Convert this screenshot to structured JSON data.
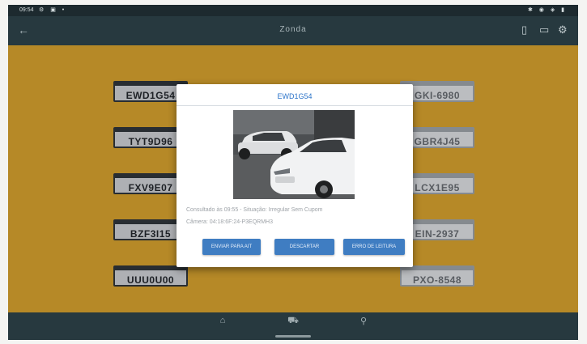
{
  "statusbar": {
    "time": "09:54",
    "left_icons": "⚙ ▣ •",
    "right_icons": "✱ ◉ ◈ ▮"
  },
  "appbar": {
    "title": "Zonda",
    "back_icon": "arrow-left-icon",
    "actions": [
      "tablet-icon",
      "chat-icon",
      "settings-icon"
    ]
  },
  "plates_left": [
    "EWD1G54",
    "TYT9D96",
    "FXV9E07",
    "BZF3I15",
    "UUU0U00"
  ],
  "plates_right": [
    "GKI-6980",
    "GBR4J45",
    "LCX1E95",
    "EIN-2937",
    "PXO-8548"
  ],
  "dialog": {
    "title": "EWD1G54",
    "info_line1": "Consultado às 09:55 - Situação: Irregular Sem Cupom",
    "info_line2": "Câmera: 04:18:6F:24-P3EQRMH3",
    "buttons": [
      "ENVIAR PARA AIT",
      "DESCARTAR",
      "ERRO DE LEITURA"
    ]
  },
  "navbar": {
    "items": [
      {
        "icon": "home-icon"
      },
      {
        "icon": "car-icon"
      },
      {
        "icon": "location-pin-icon"
      }
    ]
  },
  "colors": {
    "content_bg": "#c2922a",
    "appbar_bg": "#27393f",
    "button_blue": "#3f7dc2",
    "title_blue": "#2c74c9"
  }
}
